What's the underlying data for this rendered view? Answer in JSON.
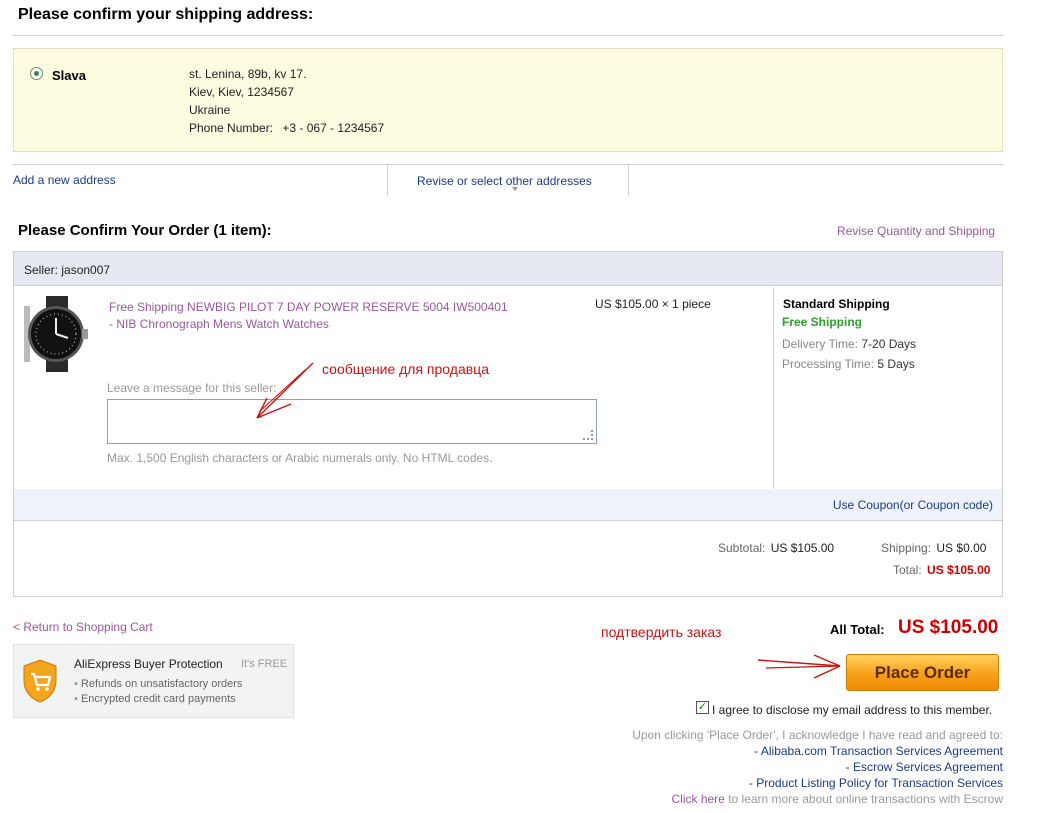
{
  "shipping": {
    "title": "Please confirm your shipping address:",
    "name": "Slava",
    "address_line1": "st. Lenina, 89b, kv 17.",
    "address_line2": "Kiev, Kiev, 1234567",
    "country": "Ukraine",
    "phone_label": "Phone Number:",
    "phone": "+3 - 067 - 1234567",
    "add_new": "Add a new address",
    "revise_select": "Revise or select other addresses"
  },
  "order": {
    "title": "Please Confirm Your Order (1 item):",
    "revise_qty": "Revise Quantity and Shipping",
    "seller": "Seller: jason007",
    "product_title_line1": "Free Shipping NEWBIG PILOT 7 DAY POWER RESERVE 5004 IW500401",
    "product_title_line2": "- NIB Chronograph Mens Watch Watches",
    "price_qty": "US $105.00 × 1 piece",
    "shipping_method": "Standard Shipping",
    "free_shipping": "Free Shipping",
    "delivery_label": "Delivery Time:",
    "delivery_value": "7-20 Days",
    "processing_label": "Processing Time:",
    "processing_value": "5 Days",
    "message_placeholder": "Leave a message for this seller:",
    "message_hint": "Max. 1,500 English characters or Arabic numerals only. No HTML codes.",
    "coupon": "Use Coupon(or Coupon code)",
    "subtotal_label": "Subtotal:",
    "subtotal_value": "US $105.00",
    "shipping_label": "Shipping:",
    "shipping_value": "US $0.00",
    "total_label": "Total:",
    "total_value": "US $105.00"
  },
  "footer": {
    "return_cart": "< Return to Shopping Cart",
    "all_total_label": "All Total:",
    "all_total_value": "US $105.00",
    "place_order": "Place Order",
    "agree_text": "I agree to disclose my email address to this member.",
    "ack_text": "Upon clicking 'Place Order', I acknowledge I have read and agreed to:",
    "agreement1": "Alibaba.com Transaction Services Agreement",
    "agreement2": "Escrow Services Agreement",
    "agreement3": "Product Listing Policy for Transaction Services",
    "dash": "-",
    "click_here": "Click here",
    "learn_more": "to learn more about online transactions with Escrow"
  },
  "protection": {
    "title": "AliExpress Buyer Protection",
    "free": "It's FREE",
    "item1": "Refunds on unsatisfactory orders",
    "item2": "Encrypted credit card payments"
  },
  "annotations": {
    "message_note": "сообщение для продавца",
    "confirm_note": "подтвердить заказ"
  },
  "icons": {
    "checked_mark": "✓",
    "bullet": "▪"
  }
}
